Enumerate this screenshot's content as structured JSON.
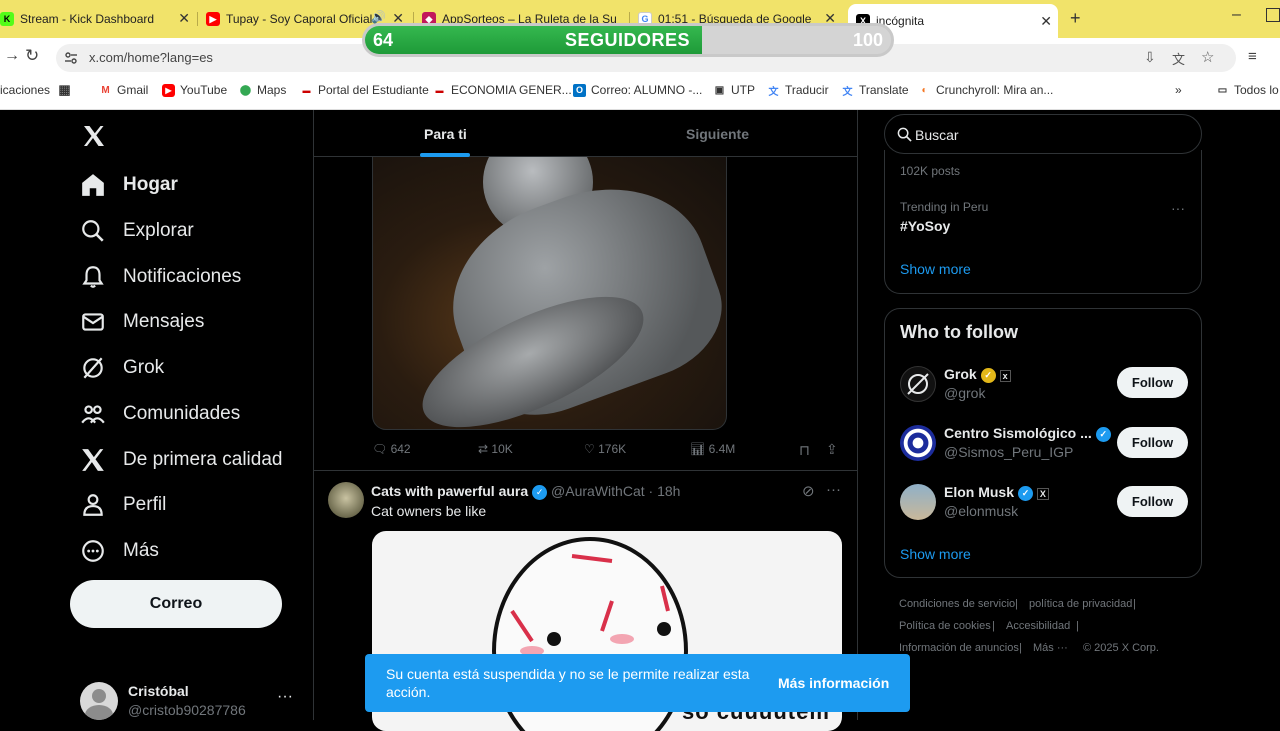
{
  "browser": {
    "tabs": [
      {
        "title": "Stream - Kick Dashboard",
        "icon": "kick-icon"
      },
      {
        "title": "Tupay - Soy Caporal Oficial",
        "icon": "youtube-icon"
      },
      {
        "title": "AppSorteos – La Ruleta de la Su",
        "icon": "appsorteos-icon"
      },
      {
        "title": "01:51 - Búsqueda de Google",
        "icon": "google-icon"
      },
      {
        "title": "incógnita",
        "icon": "x-icon"
      }
    ],
    "url": "x.com/home?lang=es",
    "bookmarks": [
      "icaciones",
      "",
      "Gmail",
      "YouTube",
      "Maps",
      "Portal del Estudiante",
      "ECONOMIA GENER...",
      "Correo: ALUMNO -...",
      "UTP",
      "Traducir",
      "Translate",
      "Crunchyroll: Mira an...",
      "Todos lo"
    ]
  },
  "overlay": {
    "current": "64",
    "label": "SEGUIDORES",
    "goal": "100",
    "progress": 0.64
  },
  "nav": {
    "items": [
      {
        "label": "Hogar",
        "icon": "home-icon"
      },
      {
        "label": "Explorar",
        "icon": "search-icon"
      },
      {
        "label": "Notificaciones",
        "icon": "bell-icon"
      },
      {
        "label": "Mensajes",
        "icon": "mail-icon"
      },
      {
        "label": "Grok",
        "icon": "grok-icon"
      },
      {
        "label": "Comunidades",
        "icon": "communities-icon"
      },
      {
        "label": "De primera calidad",
        "icon": "x-logo-icon"
      },
      {
        "label": "Perfil",
        "icon": "person-icon"
      },
      {
        "label": "Más",
        "icon": "more-circle-icon"
      }
    ],
    "post_button": "Correo",
    "account": {
      "name": "Cristóbal",
      "handle": "@cristob90287786"
    }
  },
  "feed": {
    "tabs": [
      "Para ti",
      "Siguiente"
    ],
    "post1": {
      "stats": {
        "replies": "642",
        "reposts": "10K",
        "likes": "176K",
        "views": "6.4M"
      }
    },
    "post2": {
      "name": "Cats with pawerful aura",
      "handle": "@AuraWithCat",
      "time": "· 18h",
      "text": "Cat owners be like",
      "image_caption": "so cuuuutem"
    }
  },
  "sidebar": {
    "search_placeholder": "Buscar",
    "trending": {
      "count_above": "102K posts",
      "context": "Trending in Peru",
      "topic": "#YoSoy",
      "show_more": "Show more"
    },
    "who_to_follow": {
      "title": "Who to follow",
      "accounts": [
        {
          "name": "Grok",
          "handle": "@grok",
          "button": "Follow"
        },
        {
          "name": "Centro Sismológico ...",
          "handle": "@Sismos_Peru_IGP",
          "button": "Follow"
        },
        {
          "name": "Elon Musk",
          "handle": "@elonmusk",
          "button": "Follow"
        }
      ],
      "show_more": "Show more"
    },
    "footer": {
      "terms": "Condiciones de servicio",
      "privacy": "política de privacidad",
      "cookies": "Política de cookies",
      "accessibility": "Accesibilidad",
      "ads": "Información de anuncios",
      "more": "Más ···",
      "copyright": "© 2025 X Corp."
    }
  },
  "toast": {
    "message": "Su cuenta está suspendida y no se le permite realizar esta acción.",
    "action": "Más información"
  },
  "colors": {
    "accent": "#1d9bf0",
    "toast_bg": "#1d9bf0",
    "tabbar": "#f1e36a",
    "progress_fill": "#28a745"
  }
}
